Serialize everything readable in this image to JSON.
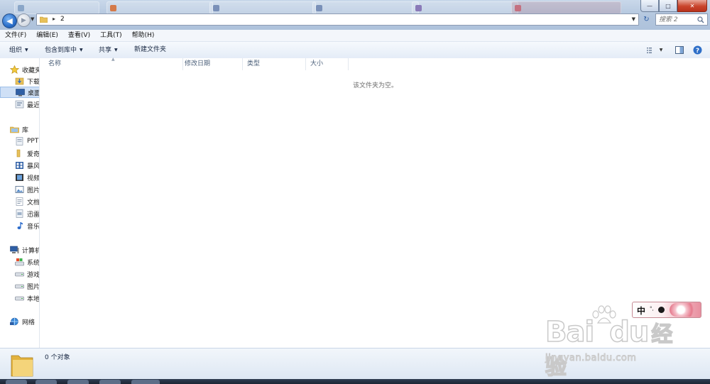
{
  "window": {
    "controls": {
      "minimize": "—",
      "maximize": "□",
      "close": "✕"
    }
  },
  "address": {
    "path_item": "2",
    "search_placeholder": "搜索 2"
  },
  "menubar": [
    "文件(F)",
    "编辑(E)",
    "查看(V)",
    "工具(T)",
    "帮助(H)"
  ],
  "toolbar": {
    "organize": "组织",
    "include_in_library": "包含到库中",
    "share": "共享",
    "new_folder": "新建文件夹"
  },
  "navigation": {
    "favorites": {
      "label": "收藏夹",
      "items": [
        "下载",
        "桌面",
        "最近"
      ]
    },
    "libraries": {
      "label": "库",
      "items": [
        "PPT",
        "爱奇",
        "暴风",
        "视频",
        "图片",
        "文档",
        "迅雷",
        "音乐"
      ]
    },
    "computer": {
      "label": "计算机",
      "items": [
        "系统",
        "游戏",
        "图片",
        "本地"
      ]
    },
    "network": {
      "label": "网络"
    }
  },
  "columns": [
    "名称",
    "修改日期",
    "类型",
    "大小"
  ],
  "empty_message": "该文件夹为空。",
  "status": {
    "item_count": "0 个对象"
  },
  "ime": {
    "mode": "中",
    "punct": "°,",
    "moon": "◐"
  },
  "watermark": {
    "brand": "Bai",
    "brand2": "du",
    "product": "经验",
    "url": "jingyan.baidu.com"
  },
  "colors": {
    "accent": "#2a6ec9",
    "close_button": "#c9442c",
    "selected_nav": "#cfe0f6"
  }
}
